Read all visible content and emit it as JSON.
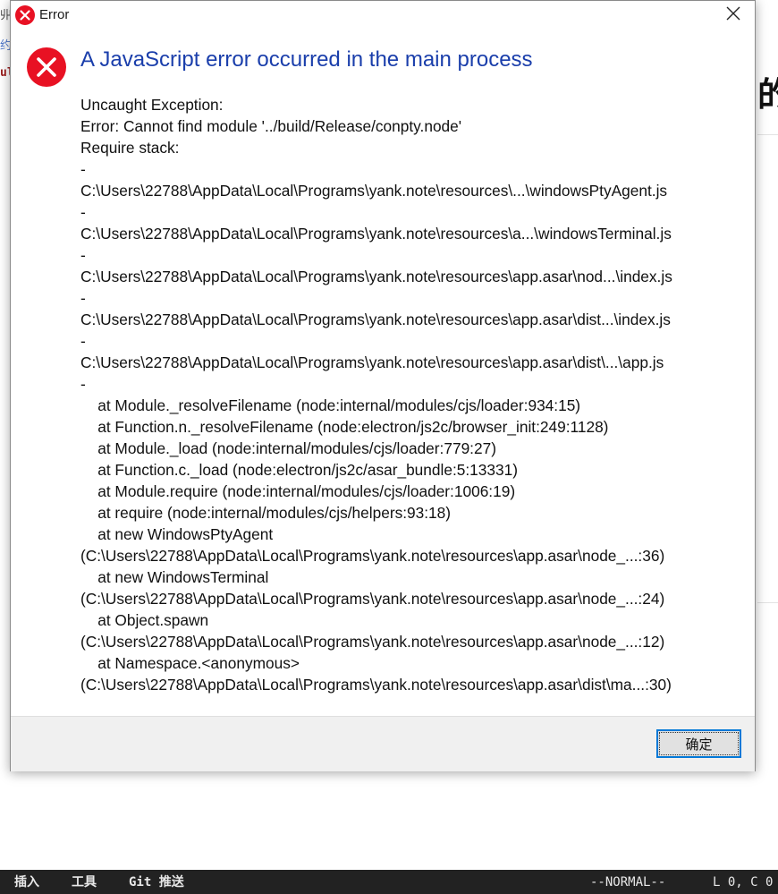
{
  "background": {
    "left_glyphs": [
      "丱",
      "约",
      "ul"
    ],
    "right_heading_glyph": "的"
  },
  "statusbar": {
    "insert": "插入",
    "tools": "工具",
    "git_push": "Git 推送",
    "mode": "--NORMAL--",
    "position": "L 0, C 0"
  },
  "dialog": {
    "title": "Error",
    "main_instruction": "A JavaScript error occurred in the main process",
    "message_lines": [
      "Uncaught Exception:",
      "Error: Cannot find module '../build/Release/conpty.node'",
      "Require stack:",
      "-",
      "C:\\Users\\22788\\AppData\\Local\\Programs\\yank.note\\resources\\...\\windowsPtyAgent.js",
      "-",
      "C:\\Users\\22788\\AppData\\Local\\Programs\\yank.note\\resources\\a...\\windowsTerminal.js",
      "-",
      "C:\\Users\\22788\\AppData\\Local\\Programs\\yank.note\\resources\\app.asar\\nod...\\index.js",
      "-",
      "C:\\Users\\22788\\AppData\\Local\\Programs\\yank.note\\resources\\app.asar\\dist...\\index.js",
      "-",
      "C:\\Users\\22788\\AppData\\Local\\Programs\\yank.note\\resources\\app.asar\\dist\\...\\app.js",
      "-",
      "    at Module._resolveFilename (node:internal/modules/cjs/loader:934:15)",
      "    at Function.n._resolveFilename (node:electron/js2c/browser_init:249:1128)",
      "    at Module._load (node:internal/modules/cjs/loader:779:27)",
      "    at Function.c._load (node:electron/js2c/asar_bundle:5:13331)",
      "    at Module.require (node:internal/modules/cjs/loader:1006:19)",
      "    at require (node:internal/modules/cjs/helpers:93:18)",
      "    at new WindowsPtyAgent",
      "(C:\\Users\\22788\\AppData\\Local\\Programs\\yank.note\\resources\\app.asar\\node_...:36)",
      "    at new WindowsTerminal",
      "(C:\\Users\\22788\\AppData\\Local\\Programs\\yank.note\\resources\\app.asar\\node_...:24)",
      "    at Object.spawn",
      "(C:\\Users\\22788\\AppData\\Local\\Programs\\yank.note\\resources\\app.asar\\node_...:12)",
      "    at Namespace.<anonymous>",
      "(C:\\Users\\22788\\AppData\\Local\\Programs\\yank.note\\resources\\app.asar\\dist\\ma...:30)"
    ],
    "ok_label": "确定",
    "icons": {
      "title": "error-icon",
      "main": "error-icon",
      "close": "close-icon"
    },
    "colors": {
      "instruction": "#1a3eab",
      "error_red": "#e81123",
      "focus_border": "#0078d7"
    }
  }
}
